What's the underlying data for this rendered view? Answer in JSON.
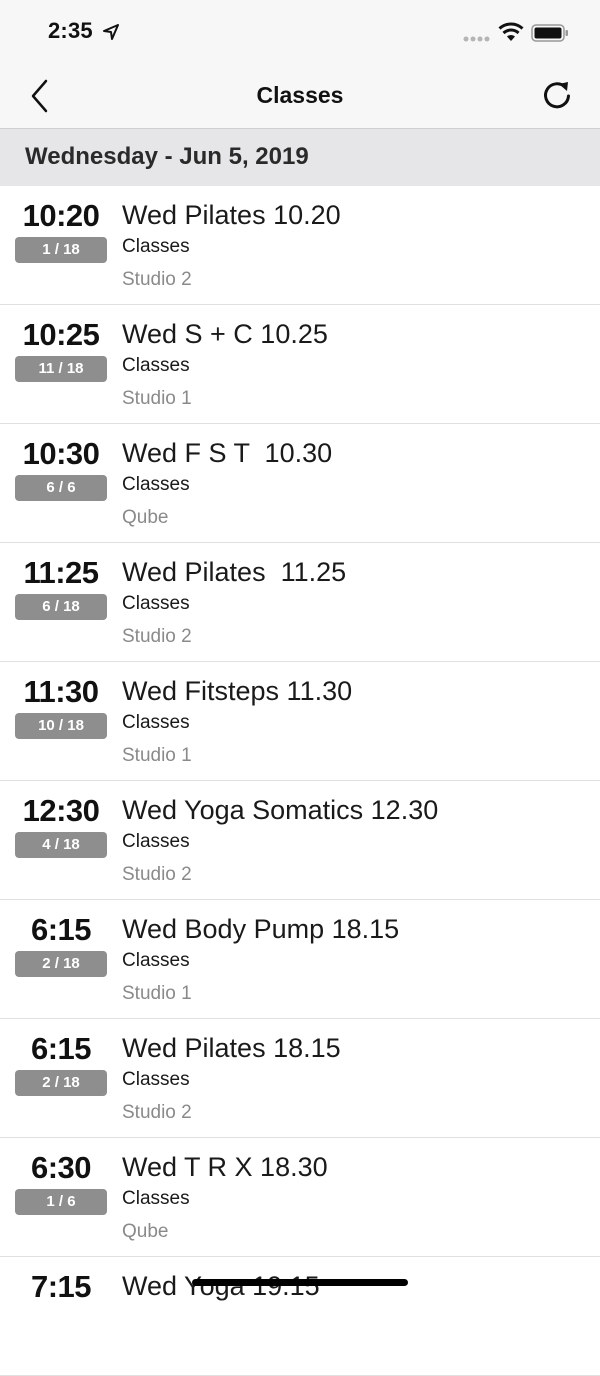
{
  "status_bar": {
    "time": "2:35"
  },
  "nav": {
    "title": "Classes"
  },
  "date_header": "Wednesday - Jun 5, 2019",
  "classes": [
    {
      "time": "10:20",
      "spots": "1 / 18",
      "name": "Wed Pilates 10.20",
      "type": "Classes",
      "room": "Studio 2"
    },
    {
      "time": "10:25",
      "spots": "11 / 18",
      "name": "Wed S + C 10.25",
      "type": "Classes",
      "room": "Studio 1"
    },
    {
      "time": "10:30",
      "spots": "6 / 6",
      "name": "Wed F S T  10.30",
      "type": "Classes",
      "room": "Qube"
    },
    {
      "time": "11:25",
      "spots": "6 / 18",
      "name": "Wed Pilates  11.25",
      "type": "Classes",
      "room": "Studio 2"
    },
    {
      "time": "11:30",
      "spots": "10 / 18",
      "name": "Wed Fitsteps 11.30",
      "type": "Classes",
      "room": "Studio 1"
    },
    {
      "time": "12:30",
      "spots": "4 / 18",
      "name": "Wed Yoga Somatics 12.30",
      "type": "Classes",
      "room": "Studio 2"
    },
    {
      "time": "6:15",
      "spots": "2 / 18",
      "name": "Wed Body Pump 18.15",
      "type": "Classes",
      "room": "Studio 1"
    },
    {
      "time": "6:15",
      "spots": "2 / 18",
      "name": "Wed Pilates 18.15",
      "type": "Classes",
      "room": "Studio 2"
    },
    {
      "time": "6:30",
      "spots": "1 / 6",
      "name": "Wed T R X 18.30",
      "type": "Classes",
      "room": "Qube"
    },
    {
      "time": "7:15",
      "spots": "",
      "name": "Wed Yoga 19.15",
      "type": "",
      "room": ""
    }
  ]
}
